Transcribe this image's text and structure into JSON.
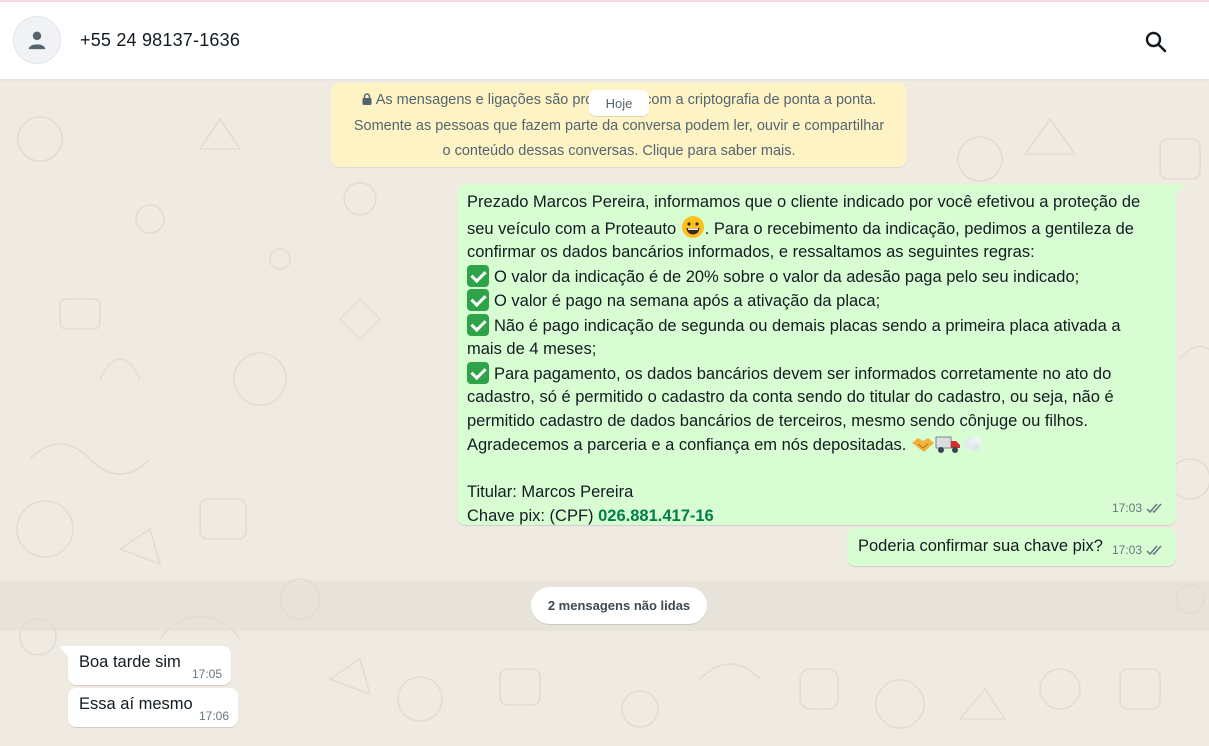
{
  "header": {
    "contact_name": "+55 24 98137-1636",
    "avatar_icon": "default-user-icon",
    "search_icon": "search-icon"
  },
  "chat": {
    "encryption_notice": {
      "line1": "As mensagens e ligações são protegidas com a criptografia de ponta a ponta.",
      "line2": "Somente as pessoas que fazem parte da conversa podem ler, ouvir e compartilhar",
      "line3": "o conteúdo dessas conversas. Clique para saber mais."
    },
    "date_label": "Hoje",
    "outgoing_message_1": {
      "lines": [
        "Prezado Marcos Pereira, informamos que o cliente indicado por você efetivou a proteção de",
        "seu veículo com a Proteauto",
        ". Para o recebimento da indicação, pedimos a gentileza de",
        "confirmar os dados bancários informados, e  ressaltamos as seguintes regras:",
        "O valor da indicação é de 20% sobre o valor da adesão paga pelo seu indicado;",
        "O valor é pago na semana após a ativação da placa;",
        "Não é pago indicação de segunda ou demais placas sendo a primeira placa ativada a",
        "mais de 4 meses;",
        "Para pagamento, os dados bancários devem ser informados corretamente no ato do",
        "cadastro, só é permitido o cadastro da conta sendo do titular do cadastro, ou seja, não é",
        "permitido cadastro de dados bancários de terceiros, mesmo sendo cônjuge ou filhos.",
        "Agradecemos a parceria e a confiança em nós depositadas.",
        "Titular: Marcos Pereira",
        "Chave pix: (CPF) ",
        "026.881.417-16"
      ],
      "time": "17:03",
      "status": "read"
    },
    "outgoing_message_2": {
      "text": "Poderia confirmar sua chave pix?",
      "time": "17:03",
      "status": "read"
    },
    "unread_banner": "2 mensagens não lidas",
    "incoming_message_1": {
      "text": "Boa tarde sim",
      "time": "17:05"
    },
    "incoming_message_2": {
      "text": "Essa aí mesmo",
      "time": "17:06"
    }
  },
  "colors": {
    "outgoing_bubble": "#d9fdd3",
    "incoming_bubble": "#ffffff",
    "encryption_bg": "#fdf3c5",
    "chat_bg": "#efeae2",
    "pix_key": "#027e4b"
  }
}
